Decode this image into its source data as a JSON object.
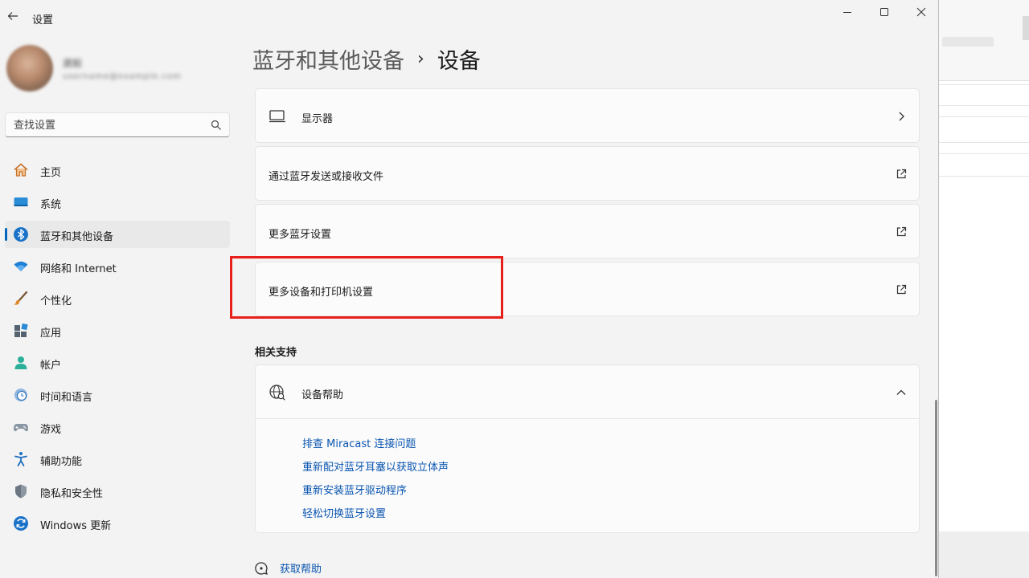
{
  "window": {
    "title": "设置"
  },
  "profile": {
    "name": "龚毅",
    "email": "username@example.com"
  },
  "search": {
    "placeholder": "查找设置"
  },
  "nav": {
    "items": [
      {
        "label": "主页",
        "icon": "home-icon"
      },
      {
        "label": "系统",
        "icon": "system-icon"
      },
      {
        "label": "蓝牙和其他设备",
        "icon": "bluetooth-icon",
        "active": true
      },
      {
        "label": "网络和 Internet",
        "icon": "wifi-icon"
      },
      {
        "label": "个性化",
        "icon": "brush-icon"
      },
      {
        "label": "应用",
        "icon": "apps-icon"
      },
      {
        "label": "帐户",
        "icon": "account-icon"
      },
      {
        "label": "时间和语言",
        "icon": "time-language-icon"
      },
      {
        "label": "游戏",
        "icon": "gaming-icon"
      },
      {
        "label": "辅助功能",
        "icon": "accessibility-icon"
      },
      {
        "label": "隐私和安全性",
        "icon": "shield-icon"
      },
      {
        "label": "Windows 更新",
        "icon": "update-icon"
      }
    ]
  },
  "header": {
    "parent": "蓝牙和其他设备",
    "separator": "›",
    "current": "设备"
  },
  "cards": [
    {
      "label": "显示器",
      "icon": "monitor-icon",
      "action": "chevron-right-icon"
    },
    {
      "label": "通过蓝牙发送或接收文件",
      "action": "external-link-icon"
    },
    {
      "label": "更多蓝牙设置",
      "action": "external-link-icon"
    },
    {
      "label": "更多设备和打印机设置",
      "action": "external-link-icon"
    }
  ],
  "support": {
    "section_title": "相关支持",
    "help": {
      "title": "设备帮助",
      "icon": "globe-help-icon",
      "links": [
        "排查 Miracast 连接问题",
        "重新配对蓝牙耳塞以获取立体声",
        "重新安装蓝牙驱动程序",
        "轻松切换蓝牙设置"
      ]
    }
  },
  "footer": {
    "get_help": "获取帮助"
  },
  "colors": {
    "accent": "#0067c0",
    "link": "#0a55b0",
    "highlight": "#e8201c"
  }
}
